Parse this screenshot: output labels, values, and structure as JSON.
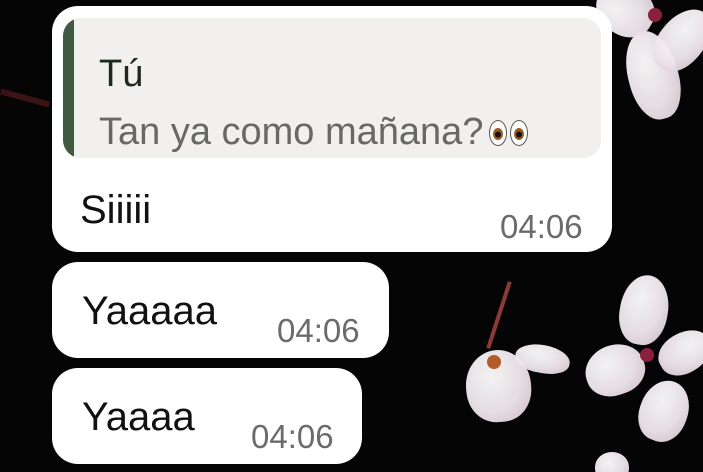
{
  "messages": [
    {
      "quote": {
        "author": "Tú",
        "text": "Tan ya como mañana?",
        "emoji": "eyes-emoji"
      },
      "text": "Siiiii",
      "time": "04:06"
    },
    {
      "text": "Yaaaaa",
      "time": "04:06"
    },
    {
      "text": "Yaaaa",
      "time": "04:06"
    }
  ],
  "colors": {
    "background": "#050505",
    "bubble": "#ffffff",
    "quote_bg": "#f1f0ee",
    "quote_bar": "#3f5a3e",
    "timestamp": "#6b6b6b"
  }
}
